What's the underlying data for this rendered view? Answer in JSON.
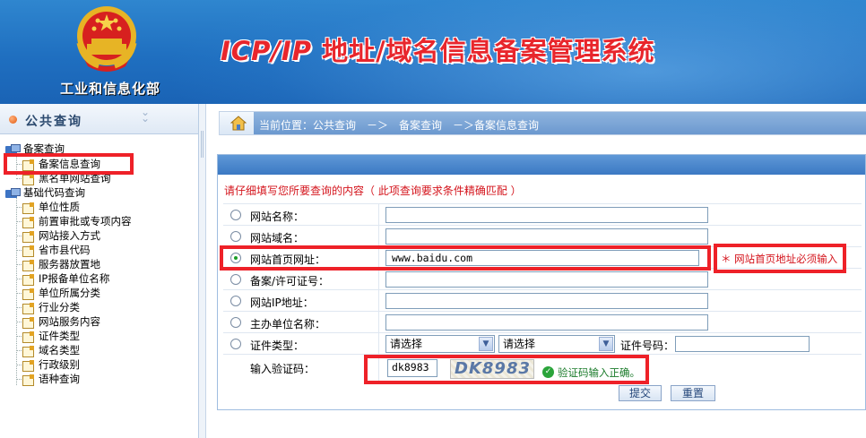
{
  "header": {
    "ministry": "工业和信息化部",
    "title_latin": "ICP/IP",
    "title_cn": "地址/域名信息备案管理系统"
  },
  "sidebar": {
    "title": "公共查询",
    "groups": [
      {
        "label": "备案查询",
        "items": [
          "备案信息查询",
          "黑名单网站查询"
        ]
      },
      {
        "label": "基础代码查询",
        "items": [
          "单位性质",
          "前置审批或专项内容",
          "网站接入方式",
          "省市县代码",
          "服务器放置地",
          "IP报备单位名称",
          "单位所属分类",
          "行业分类",
          "网站服务内容",
          "证件类型",
          "域名类型",
          "行政级别",
          "语种查询"
        ]
      }
    ]
  },
  "breadcrumb": {
    "text": "当前位置：公共查询　－＞　备案查询　－＞备案信息查询"
  },
  "form": {
    "hint": "请仔细填写您所要查询的内容（ 此项查询要求条件精确匹配 ）",
    "fields": [
      {
        "label": "网站名称：",
        "value": ""
      },
      {
        "label": "网站域名：",
        "value": ""
      },
      {
        "label": "网站首页网址：",
        "value": "www.baidu.com",
        "selected": true
      },
      {
        "label": "备案/许可证号：",
        "value": ""
      },
      {
        "label": "网站IP地址：",
        "value": ""
      },
      {
        "label": "主办单位名称：",
        "value": ""
      },
      {
        "label": "证件类型：",
        "value": ""
      }
    ],
    "required_note": "＊ 网站首页地址必须输入",
    "cert_select_1": "请选择",
    "cert_select_2": "请选择",
    "cert_number_label": "证件号码：",
    "captcha_label": "输入验证码：",
    "captcha_value": "dk8983",
    "captcha_image_text": "DK8983",
    "captcha_ok": "验证码输入正确。",
    "submit_label": "提交",
    "reset_label": "重置"
  },
  "colors": {
    "header_blue": "#1f6fc0",
    "highlight_red": "#ee2128",
    "hint_red": "#d4141c"
  }
}
